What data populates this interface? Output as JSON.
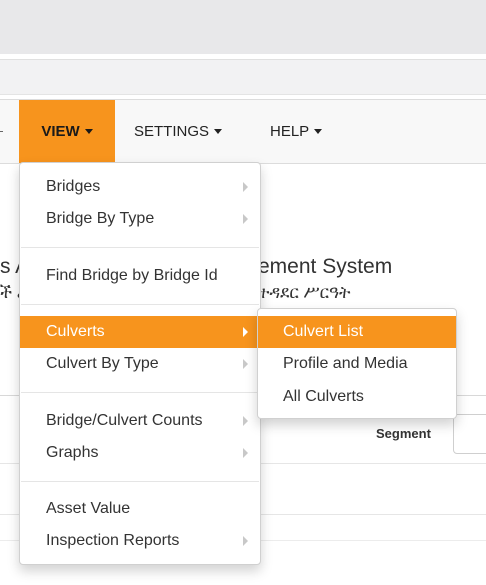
{
  "nav": {
    "view": "VIEW",
    "settings": "SETTINGS",
    "help": "HELP"
  },
  "background": {
    "title_left": "s A",
    "title_right": "ement System",
    "sub_left": "ች ሪ",
    "sub_right": "ተዳደር ሥርዓት",
    "segment_label": "Segment"
  },
  "view_menu": {
    "items": [
      {
        "label": "Bridges"
      },
      {
        "label": "Bridge By Type"
      },
      {
        "label": "Find Bridge by Bridge Id"
      },
      {
        "label": "Culverts"
      },
      {
        "label": "Culvert By Type"
      },
      {
        "label": "Bridge/Culvert Counts"
      },
      {
        "label": "Graphs"
      },
      {
        "label": "Asset Value"
      },
      {
        "label": "Inspection Reports"
      }
    ]
  },
  "culverts_submenu": {
    "items": [
      {
        "label": "Culvert List"
      },
      {
        "label": "Profile and Media"
      },
      {
        "label": "All Culverts"
      }
    ]
  },
  "colors": {
    "accent": "#f7941d",
    "navbar_bg": "#f8f8f8",
    "top_strip": "#e8e8ea"
  }
}
